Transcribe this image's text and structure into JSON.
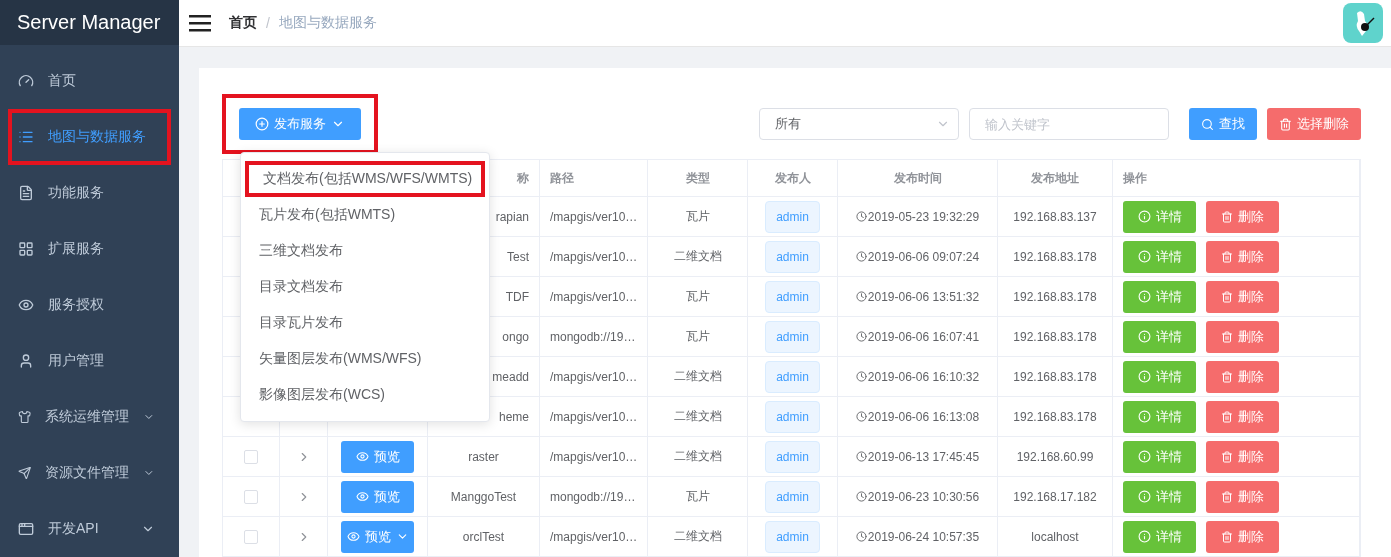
{
  "sidebar": {
    "title": "Server Manager",
    "items": [
      {
        "label": "首页",
        "selected": false,
        "expandable": false,
        "annotated": false
      },
      {
        "label": "地图与数据服务",
        "selected": true,
        "expandable": false,
        "annotated": true
      },
      {
        "label": "功能服务",
        "selected": false,
        "expandable": false,
        "annotated": false
      },
      {
        "label": "扩展服务",
        "selected": false,
        "expandable": false,
        "annotated": false
      },
      {
        "label": "服务授权",
        "selected": false,
        "expandable": false,
        "annotated": false
      },
      {
        "label": "用户管理",
        "selected": false,
        "expandable": false,
        "annotated": false
      },
      {
        "label": "系统运维管理",
        "selected": false,
        "expandable": true,
        "annotated": false
      },
      {
        "label": "资源文件管理",
        "selected": false,
        "expandable": true,
        "annotated": false
      },
      {
        "label": "开发API",
        "selected": false,
        "expandable": true,
        "annotated": false
      }
    ]
  },
  "breadcrumb": {
    "items": [
      "首页",
      "地图与数据服务"
    ],
    "separator": "/"
  },
  "toolbar": {
    "publish_button": {
      "label": "发布服务",
      "annotated": true
    },
    "filter": {
      "value": "所有"
    },
    "search": {
      "placeholder": "输入关键字"
    },
    "find_button": "查找",
    "delete_selected_button": "选择删除"
  },
  "publish_menu": [
    {
      "label": "文档发布(包括WMS/WFS/WMTS)",
      "annotated": true
    },
    {
      "label": "瓦片发布(包括WMTS)",
      "annotated": false
    },
    {
      "label": "三维文档发布",
      "annotated": false
    },
    {
      "label": "目录文档发布",
      "annotated": false
    },
    {
      "label": "目录瓦片发布",
      "annotated": false
    },
    {
      "label": "矢量图层发布(WMS/WFS)",
      "annotated": false
    },
    {
      "label": "影像图层发布(WCS)",
      "annotated": false
    }
  ],
  "table": {
    "columns": [
      "称",
      "路径",
      "类型",
      "发布人",
      "发布时间",
      "发布地址",
      "操作"
    ],
    "rows": [
      {
        "name": "rapian",
        "path": "/mapgis/ver10…",
        "type": "瓦片",
        "publisher": "admin",
        "time": "2019-05-23 19:32:29",
        "address": "192.168.83.137",
        "detail": "详情",
        "delete": "删除"
      },
      {
        "name": "Test",
        "path": "/mapgis/ver10…",
        "type": "二维文档",
        "publisher": "admin",
        "time": "2019-06-06 09:07:24",
        "address": "192.168.83.178",
        "detail": "详情",
        "delete": "删除"
      },
      {
        "name": "TDF",
        "path": "/mapgis/ver10…",
        "type": "瓦片",
        "publisher": "admin",
        "time": "2019-06-06 13:51:32",
        "address": "192.168.83.178",
        "detail": "详情",
        "delete": "删除"
      },
      {
        "name": "ongo",
        "path": "mongodb://19…",
        "type": "瓦片",
        "publisher": "admin",
        "time": "2019-06-06 16:07:41",
        "address": "192.168.83.178",
        "detail": "详情",
        "delete": "删除"
      },
      {
        "name": "meadd",
        "path": "/mapgis/ver10…",
        "type": "二维文档",
        "publisher": "admin",
        "time": "2019-06-06 16:10:32",
        "address": "192.168.83.178",
        "detail": "详情",
        "delete": "删除"
      },
      {
        "name": "heme",
        "path": "/mapgis/ver10…",
        "type": "二维文档",
        "publisher": "admin",
        "time": "2019-06-06 16:13:08",
        "address": "192.168.83.178",
        "detail": "详情",
        "delete": "删除"
      },
      {
        "checked": false,
        "preview": {
          "label": "预览",
          "has_menu": false
        },
        "name": "raster",
        "path": "/mapgis/ver10…",
        "type": "二维文档",
        "publisher": "admin",
        "time": "2019-06-13 17:45:45",
        "address": "192.168.60.99",
        "detail": "详情",
        "delete": "删除"
      },
      {
        "checked": false,
        "preview": {
          "label": "预览",
          "has_menu": false
        },
        "name": "ManggoTest",
        "path": "mongodb://19…",
        "type": "瓦片",
        "publisher": "admin",
        "time": "2019-06-23 10:30:56",
        "address": "192.168.17.182",
        "detail": "详情",
        "delete": "删除"
      },
      {
        "checked": false,
        "preview": {
          "label": "预览",
          "has_menu": true
        },
        "name": "orclTest",
        "path": "/mapgis/ver10…",
        "type": "二维文档",
        "publisher": "admin",
        "time": "2019-06-24 10:57:35",
        "address": "localhost",
        "detail": "详情",
        "delete": "删除"
      }
    ]
  }
}
